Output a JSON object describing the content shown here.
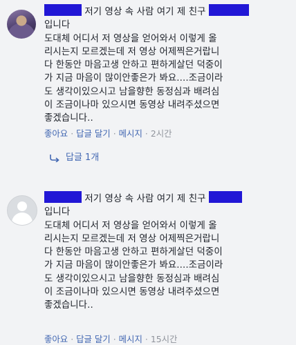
{
  "comments": [
    {
      "author_suffix": "저기 영상 속 사람 여기 제 친구",
      "lines": [
        "입니다",
        "도대체 어디서 저 영상을 얻어와서 이렇게 올",
        "리시는지 모르겠는데 저 영상 어제찍은거랍니",
        "다 한동안 마음고생 안하고 편하게살던 덕중이",
        "가 지금 마음이 많이안좋은가 봐요....조금이라",
        "도 생각이있으시고 남을향한 동정심과 배려심",
        "이 조금이나마 있으시면 동영상 내려주셨으면",
        "좋겠습니다.."
      ],
      "like": "좋아요",
      "reply": "답글 달기",
      "message": "메시지",
      "time": "2시간"
    },
    {
      "author_suffix": "저기 영상 속 사람 여기 제 친구",
      "lines": [
        "입니다",
        "도대체 어디서 저 영상을 얻어와서 이렇게 올",
        "리시는지 모르겠는데 저 영상 어제찍은거랍니",
        "다 한동안 마음고생 안하고 편하게살던 덕중이",
        "가 지금 마음이 많이안좋은가 봐요....조금이라",
        "도 생각이있으시고 남을향한 동정심과 배려심",
        "이 조금이나마 있으시면 동영상 내려주셨으면",
        "좋겠습니다.."
      ],
      "like": "좋아요",
      "reply": "답글 달기",
      "message": "메시지",
      "time": "15시간"
    }
  ],
  "replies_link": "답글 1개",
  "colors": {
    "redaction": "#2117d6",
    "link": "#4267b2",
    "background": "#f2f3f5"
  }
}
